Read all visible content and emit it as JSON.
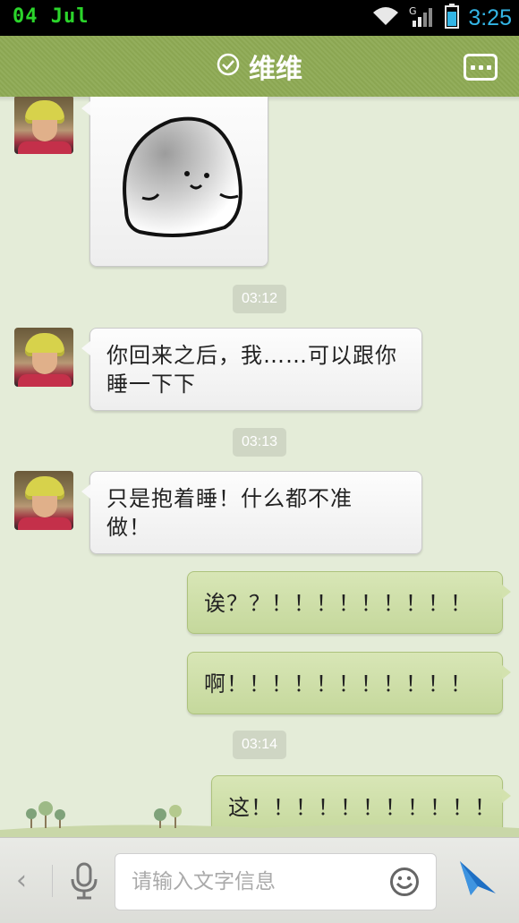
{
  "status_bar": {
    "date": "04  Jul",
    "network_label": "G",
    "time": "3:25"
  },
  "header": {
    "title": "维维",
    "verified_icon": "check-circle-icon",
    "menu_icon": "more-dots-icon"
  },
  "messages": [
    {
      "kind": "sticker",
      "side": "left",
      "sticker": "blob-character-sticker"
    },
    {
      "kind": "time",
      "text": "03:12"
    },
    {
      "kind": "text",
      "side": "left",
      "text": "你回来之后，我……可以跟你\n睡一下下"
    },
    {
      "kind": "time",
      "text": "03:13"
    },
    {
      "kind": "text",
      "side": "left",
      "text": "只是抱着睡！什么都不准\n做！"
    },
    {
      "kind": "text",
      "side": "right",
      "text": "诶？？！！！！！！！！！"
    },
    {
      "kind": "text",
      "side": "right",
      "text": "啊！！！！！！！！！！！"
    },
    {
      "kind": "time",
      "text": "03:14"
    },
    {
      "kind": "text",
      "side": "right",
      "text": "这！！！！！！！！！！！"
    }
  ],
  "input_bar": {
    "back_icon": "chevron-left-icon",
    "voice_icon": "microphone-icon",
    "placeholder": "请输入文字信息",
    "emoji_icon": "smiley-icon",
    "send_icon": "send-arrow-icon"
  },
  "colors": {
    "header_bg": "#8fab55",
    "chat_bg": "#e4ecd8",
    "outgoing_bubble": "#cfdfa9",
    "incoming_bubble": "#f6f6f6",
    "clock": "#33b5e5"
  }
}
